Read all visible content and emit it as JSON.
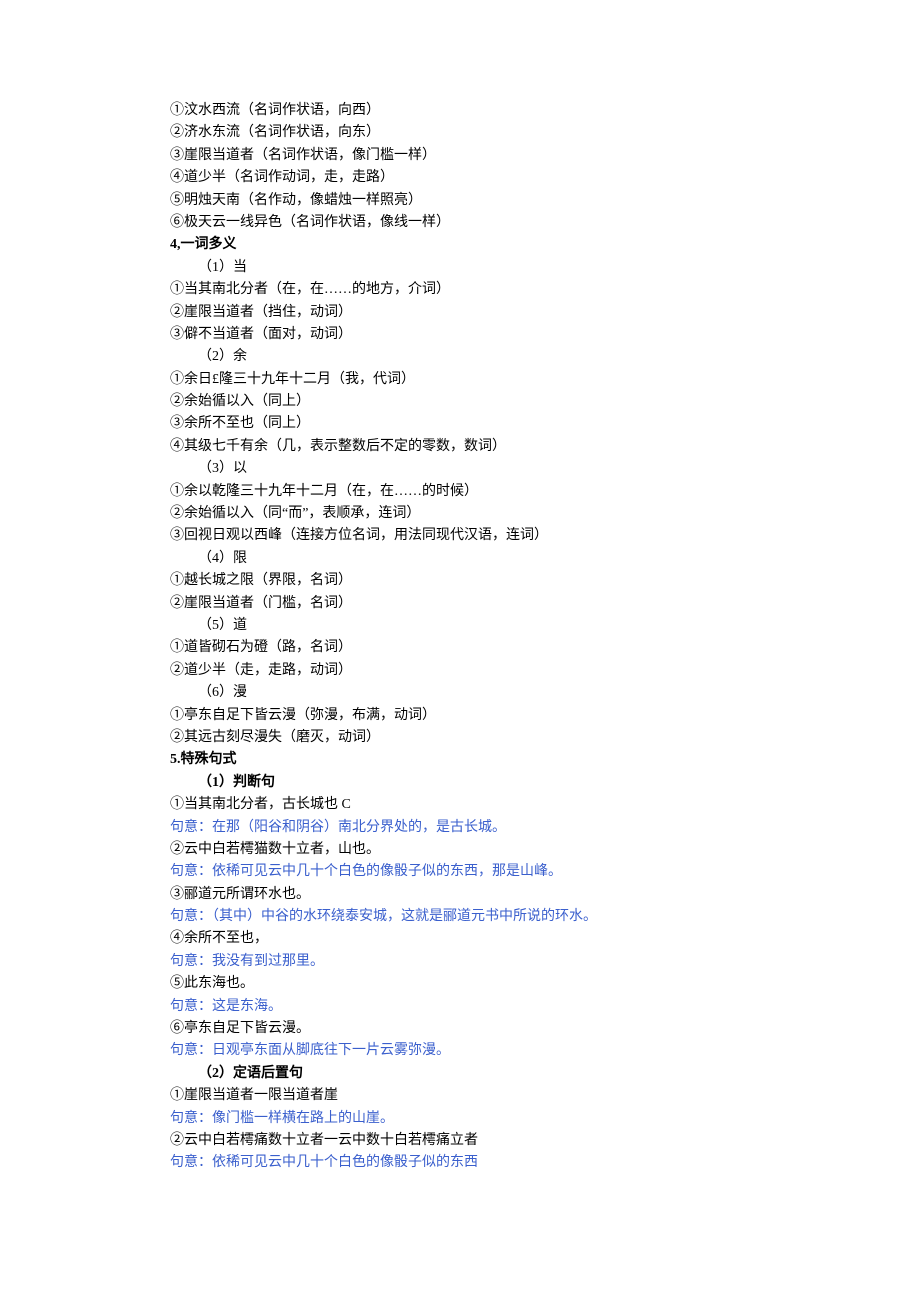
{
  "sec3": {
    "items": [
      "①汶水西流（名词作状语，向西）",
      "②济水东流（名词作状语，向东）",
      "③崖限当道者（名词作状语，像门槛一样）",
      "④道少半（名词作动词，走，走路）",
      "⑤明烛天南（名作动，像蜡烛一样照亮）",
      "⑥极天云一线异色（名词作状语，像线一样）"
    ]
  },
  "sec4": {
    "title": "4,一词多义",
    "g1": {
      "head": "（1）当",
      "items": [
        "①当其南北分者（在，在……的地方，介词）",
        "②崖限当道者（挡住，动词）",
        "③僻不当道者（面对，动词）"
      ]
    },
    "g2": {
      "head": "（2）余",
      "items": [
        "①余日£隆三十九年十二月（我，代词）",
        "②余始循以入（同上）",
        "③余所不至也（同上）",
        "④其级七千有余（几，表示整数后不定的零数，数词）"
      ]
    },
    "g3": {
      "head": "（3）以",
      "items": [
        "①余以乾隆三十九年十二月（在，在……的时候）",
        "②余始循以入（同“而”，表顺承，连词）",
        "③回视日观以西峰（连接方位名词，用法同现代汉语，连词）"
      ]
    },
    "g4": {
      "head": "（4）限",
      "items": [
        "①越长城之限（界限，名词）",
        "②崖限当道者（门槛，名词）"
      ]
    },
    "g5": {
      "head": "（5）道",
      "items": [
        "①道皆砌石为磴（路，名词）",
        "②道少半（走，走路，动词）"
      ]
    },
    "g6": {
      "head": "（6）漫",
      "items": [
        "①亭东自足下皆云漫（弥漫，布满，动词）",
        "②其远古刻尽漫失（磨灭，动词）"
      ]
    }
  },
  "sec5": {
    "title": "5.特殊句式",
    "p1": {
      "head": "（1）判断句",
      "items": [
        {
          "t": "①当其南北分者，古长城也 C",
          "b": "句意：在那（阳谷和阴谷）南北分界处的，是古长城。"
        },
        {
          "t": "②云中白若樗猫数十立者，山也。",
          "b": "句意：依稀可见云中几十个白色的像骰子似的东西，那是山峰。"
        },
        {
          "t": "③郦道元所谓环水也。",
          "b": "句意：（其中）中谷的水环绕泰安城，这就是郦道元书中所说的环水。"
        },
        {
          "t": "④余所不至也，",
          "b": "句意：我没有到过那里。"
        },
        {
          "t": "⑤此东海也。",
          "b": "句意：这是东海。"
        },
        {
          "t": "⑥亭东自足下皆云漫。",
          "b": "句意：日观亭东面从脚底往下一片云雾弥漫。"
        }
      ]
    },
    "p2": {
      "head": "（2）定语后置句",
      "items": [
        {
          "t": "①崖限当道者一限当道者崖",
          "b": "句意：像门槛一样横在路上的山崖。"
        },
        {
          "t": "②云中白若樗痛数十立者一云中数十白若樗痛立者",
          "b": "句意：依稀可见云中几十个白色的像骰子似的东西"
        }
      ]
    }
  }
}
